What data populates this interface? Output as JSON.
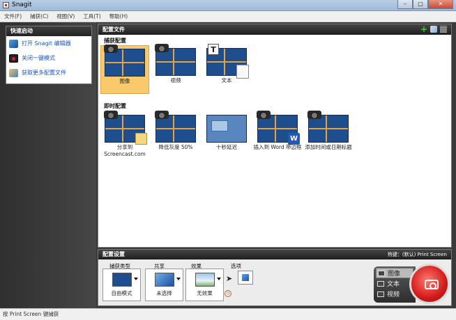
{
  "window": {
    "title": "Snagit",
    "minimize": "–",
    "maximize": "□",
    "close": "✕"
  },
  "menu": [
    "文件(F)",
    "捕获(C)",
    "视图(V)",
    "工具(T)",
    "帮助(H)"
  ],
  "quick_launch": {
    "title": "快速启动",
    "items": [
      {
        "label": "打开 Snagit 编辑器",
        "icon": "editor-icon"
      },
      {
        "label": "关闭一键模式",
        "icon": "one-click-icon"
      },
      {
        "label": "获取更多配置文件",
        "icon": "puzzle-icon"
      }
    ]
  },
  "profiles": {
    "title": "配置文件",
    "header_icons": [
      "add-icon",
      "edit-icon",
      "grid-icon"
    ],
    "capture_section": "捕获配置",
    "capture_items": [
      {
        "label": "图像",
        "selected": true
      },
      {
        "label": "视频",
        "selected": false
      },
      {
        "label": "文本",
        "selected": false
      }
    ],
    "instant_section": "即时配置",
    "instant_items": [
      {
        "label": "分享到 Screencast.com"
      },
      {
        "label": "降低灰度 50%"
      },
      {
        "label": "十秒延迟"
      },
      {
        "label": "插入到 Word 带边框"
      },
      {
        "label": "添加时间或日期标题"
      }
    ]
  },
  "config": {
    "title": "配置设置",
    "hotkey": "热键：(默认) Print  Screen",
    "groups": [
      {
        "label": "捕获类型",
        "value": "自由模式"
      },
      {
        "label": "共享",
        "value": "未选择"
      },
      {
        "label": "效果",
        "value": "无效果"
      }
    ],
    "options_label": "选项"
  },
  "capture_modes": [
    {
      "label": "图像",
      "selected": true
    },
    {
      "label": "文本",
      "selected": false
    },
    {
      "label": "视频",
      "selected": false
    }
  ],
  "status": "按 Print Screen 键捕获"
}
